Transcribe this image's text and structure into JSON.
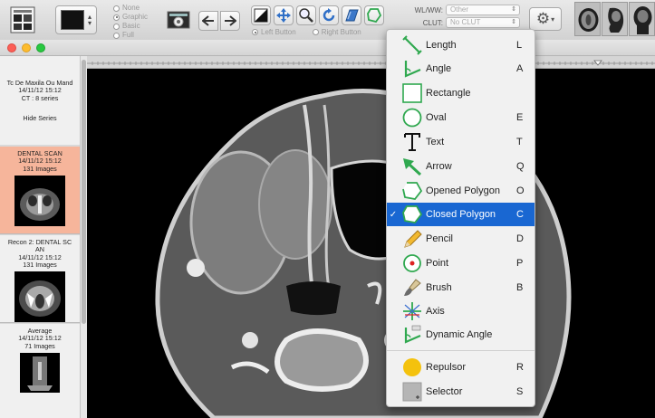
{
  "overlay": {
    "title": "",
    "options": [
      "None",
      "Graphic",
      "Basic",
      "Full"
    ],
    "selected": "Graphic"
  },
  "mouse_buttons": {
    "left": "Left Button",
    "right": "Right Button",
    "selected": "Left Button"
  },
  "wlww": {
    "label": "WL/WW:",
    "value": "Other"
  },
  "clut": {
    "label": "CLUT:",
    "value": "No CLUT"
  },
  "study": {
    "name": "Tc De Maxila Ou Mand",
    "date": "14/11/12 15:12",
    "modality": "CT : 8 series",
    "hide_label": "Hide Series"
  },
  "series": [
    {
      "name": "DENTAL SCAN",
      "date": "14/11/12 15:12",
      "count": "131 Images",
      "selected": true
    },
    {
      "name_line1": "Recon 2: DENTAL SC",
      "name_line2": "AN",
      "date": "14/11/12 15:12",
      "count": "131 Images"
    },
    {
      "name": "Average",
      "date": "14/11/12 15:12",
      "count": "71 Images"
    }
  ],
  "menu": {
    "items": [
      {
        "label": "Length",
        "key": "L",
        "icon": "length-icon"
      },
      {
        "label": "Angle",
        "key": "A",
        "icon": "angle-icon"
      },
      {
        "label": "Rectangle",
        "key": "",
        "icon": "rectangle-icon"
      },
      {
        "label": "Oval",
        "key": "E",
        "icon": "oval-icon"
      },
      {
        "label": "Text",
        "key": "T",
        "icon": "text-icon"
      },
      {
        "label": "Arrow",
        "key": "Q",
        "icon": "arrow-icon"
      },
      {
        "label": "Opened Polygon",
        "key": "O",
        "icon": "opened-polygon-icon"
      },
      {
        "label": "Closed Polygon",
        "key": "C",
        "icon": "closed-polygon-icon",
        "checked": true
      },
      {
        "label": "Pencil",
        "key": "D",
        "icon": "pencil-icon"
      },
      {
        "label": "Point",
        "key": "P",
        "icon": "point-icon"
      },
      {
        "label": "Brush",
        "key": "B",
        "icon": "brush-icon"
      },
      {
        "label": "Axis",
        "key": "",
        "icon": "axis-icon"
      },
      {
        "label": "Dynamic Angle",
        "key": "",
        "icon": "dynamic-angle-icon"
      },
      {
        "label": "Repulsor",
        "key": "R",
        "icon": "repulsor-icon"
      },
      {
        "label": "Selector",
        "key": "S",
        "icon": "selector-icon"
      }
    ],
    "check_mark": "✓"
  },
  "colors": {
    "menu_highlight": "#1967d2",
    "selected_series": "#f6b59b",
    "tool_icon_green": "#2fa84f",
    "repulsor_yellow": "#f4c20d"
  }
}
